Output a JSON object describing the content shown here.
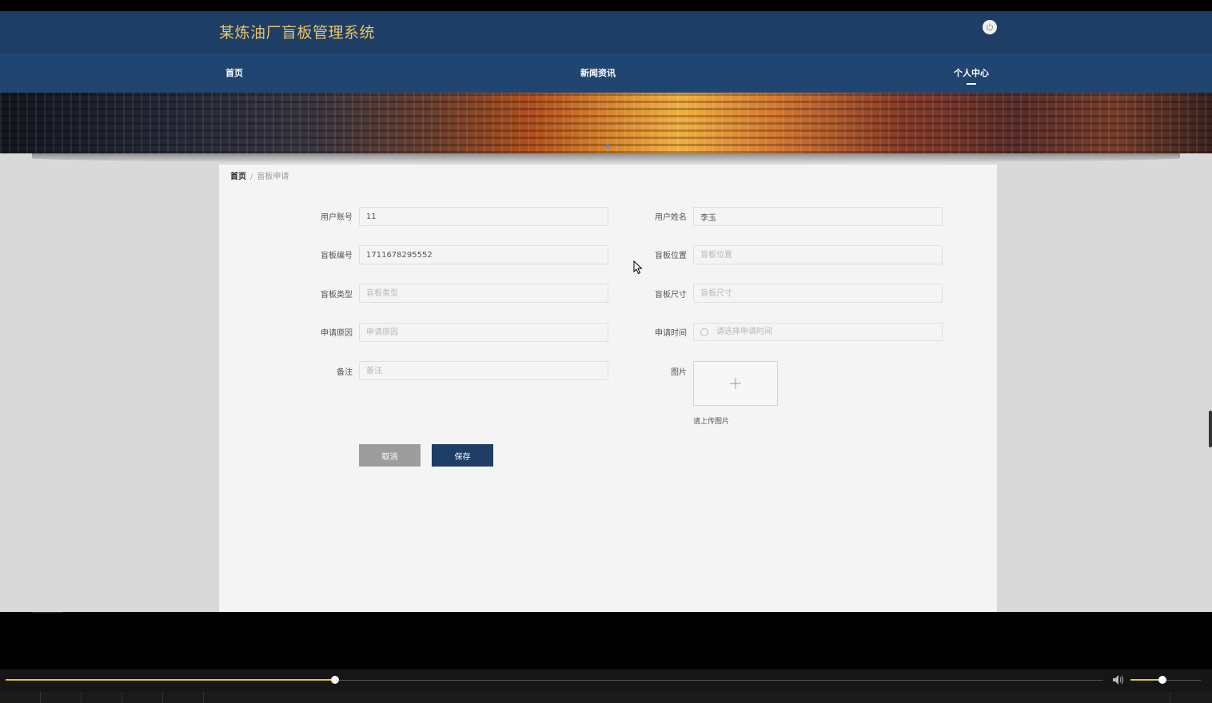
{
  "header": {
    "title": "某炼油厂盲板管理系统",
    "power_icon": "power-icon"
  },
  "nav": {
    "items": [
      {
        "label": "首页"
      },
      {
        "label": "新闻资讯"
      },
      {
        "label": "个人中心",
        "active": true
      }
    ]
  },
  "breadcrumb": {
    "home": "首页",
    "separator": "/",
    "current": "盲板申请"
  },
  "form": {
    "fields": {
      "user_account": {
        "label": "用户账号",
        "value": "11",
        "placeholder": ""
      },
      "user_name": {
        "label": "用户姓名",
        "value": "李玉",
        "placeholder": ""
      },
      "board_number": {
        "label": "盲板编号",
        "value": "1711678295552",
        "placeholder": ""
      },
      "board_location": {
        "label": "盲板位置",
        "value": "",
        "placeholder": "盲板位置"
      },
      "board_type": {
        "label": "盲板类型",
        "value": "",
        "placeholder": "盲板类型"
      },
      "board_size": {
        "label": "盲板尺寸",
        "value": "",
        "placeholder": "盲板尺寸"
      },
      "apply_reason": {
        "label": "申请原因",
        "value": "",
        "placeholder": "申请原因"
      },
      "apply_time": {
        "label": "申请时间",
        "value": "",
        "placeholder": "请选择申请时间"
      },
      "remark": {
        "label": "备注",
        "value": "",
        "placeholder": "备注"
      },
      "image": {
        "label": "图片",
        "hint": "请上传图片"
      }
    },
    "buttons": {
      "cancel": "取消",
      "save": "保存"
    }
  },
  "player": {
    "progress": 0.3,
    "volume": 0.45
  },
  "colors": {
    "header_bg": "#1e3e66",
    "nav_bg": "#1f4570",
    "title_gold": "#e9c46a",
    "save_button": "#1e3e66",
    "cancel_button": "#9d9d9d",
    "progress": "#e3c531"
  }
}
